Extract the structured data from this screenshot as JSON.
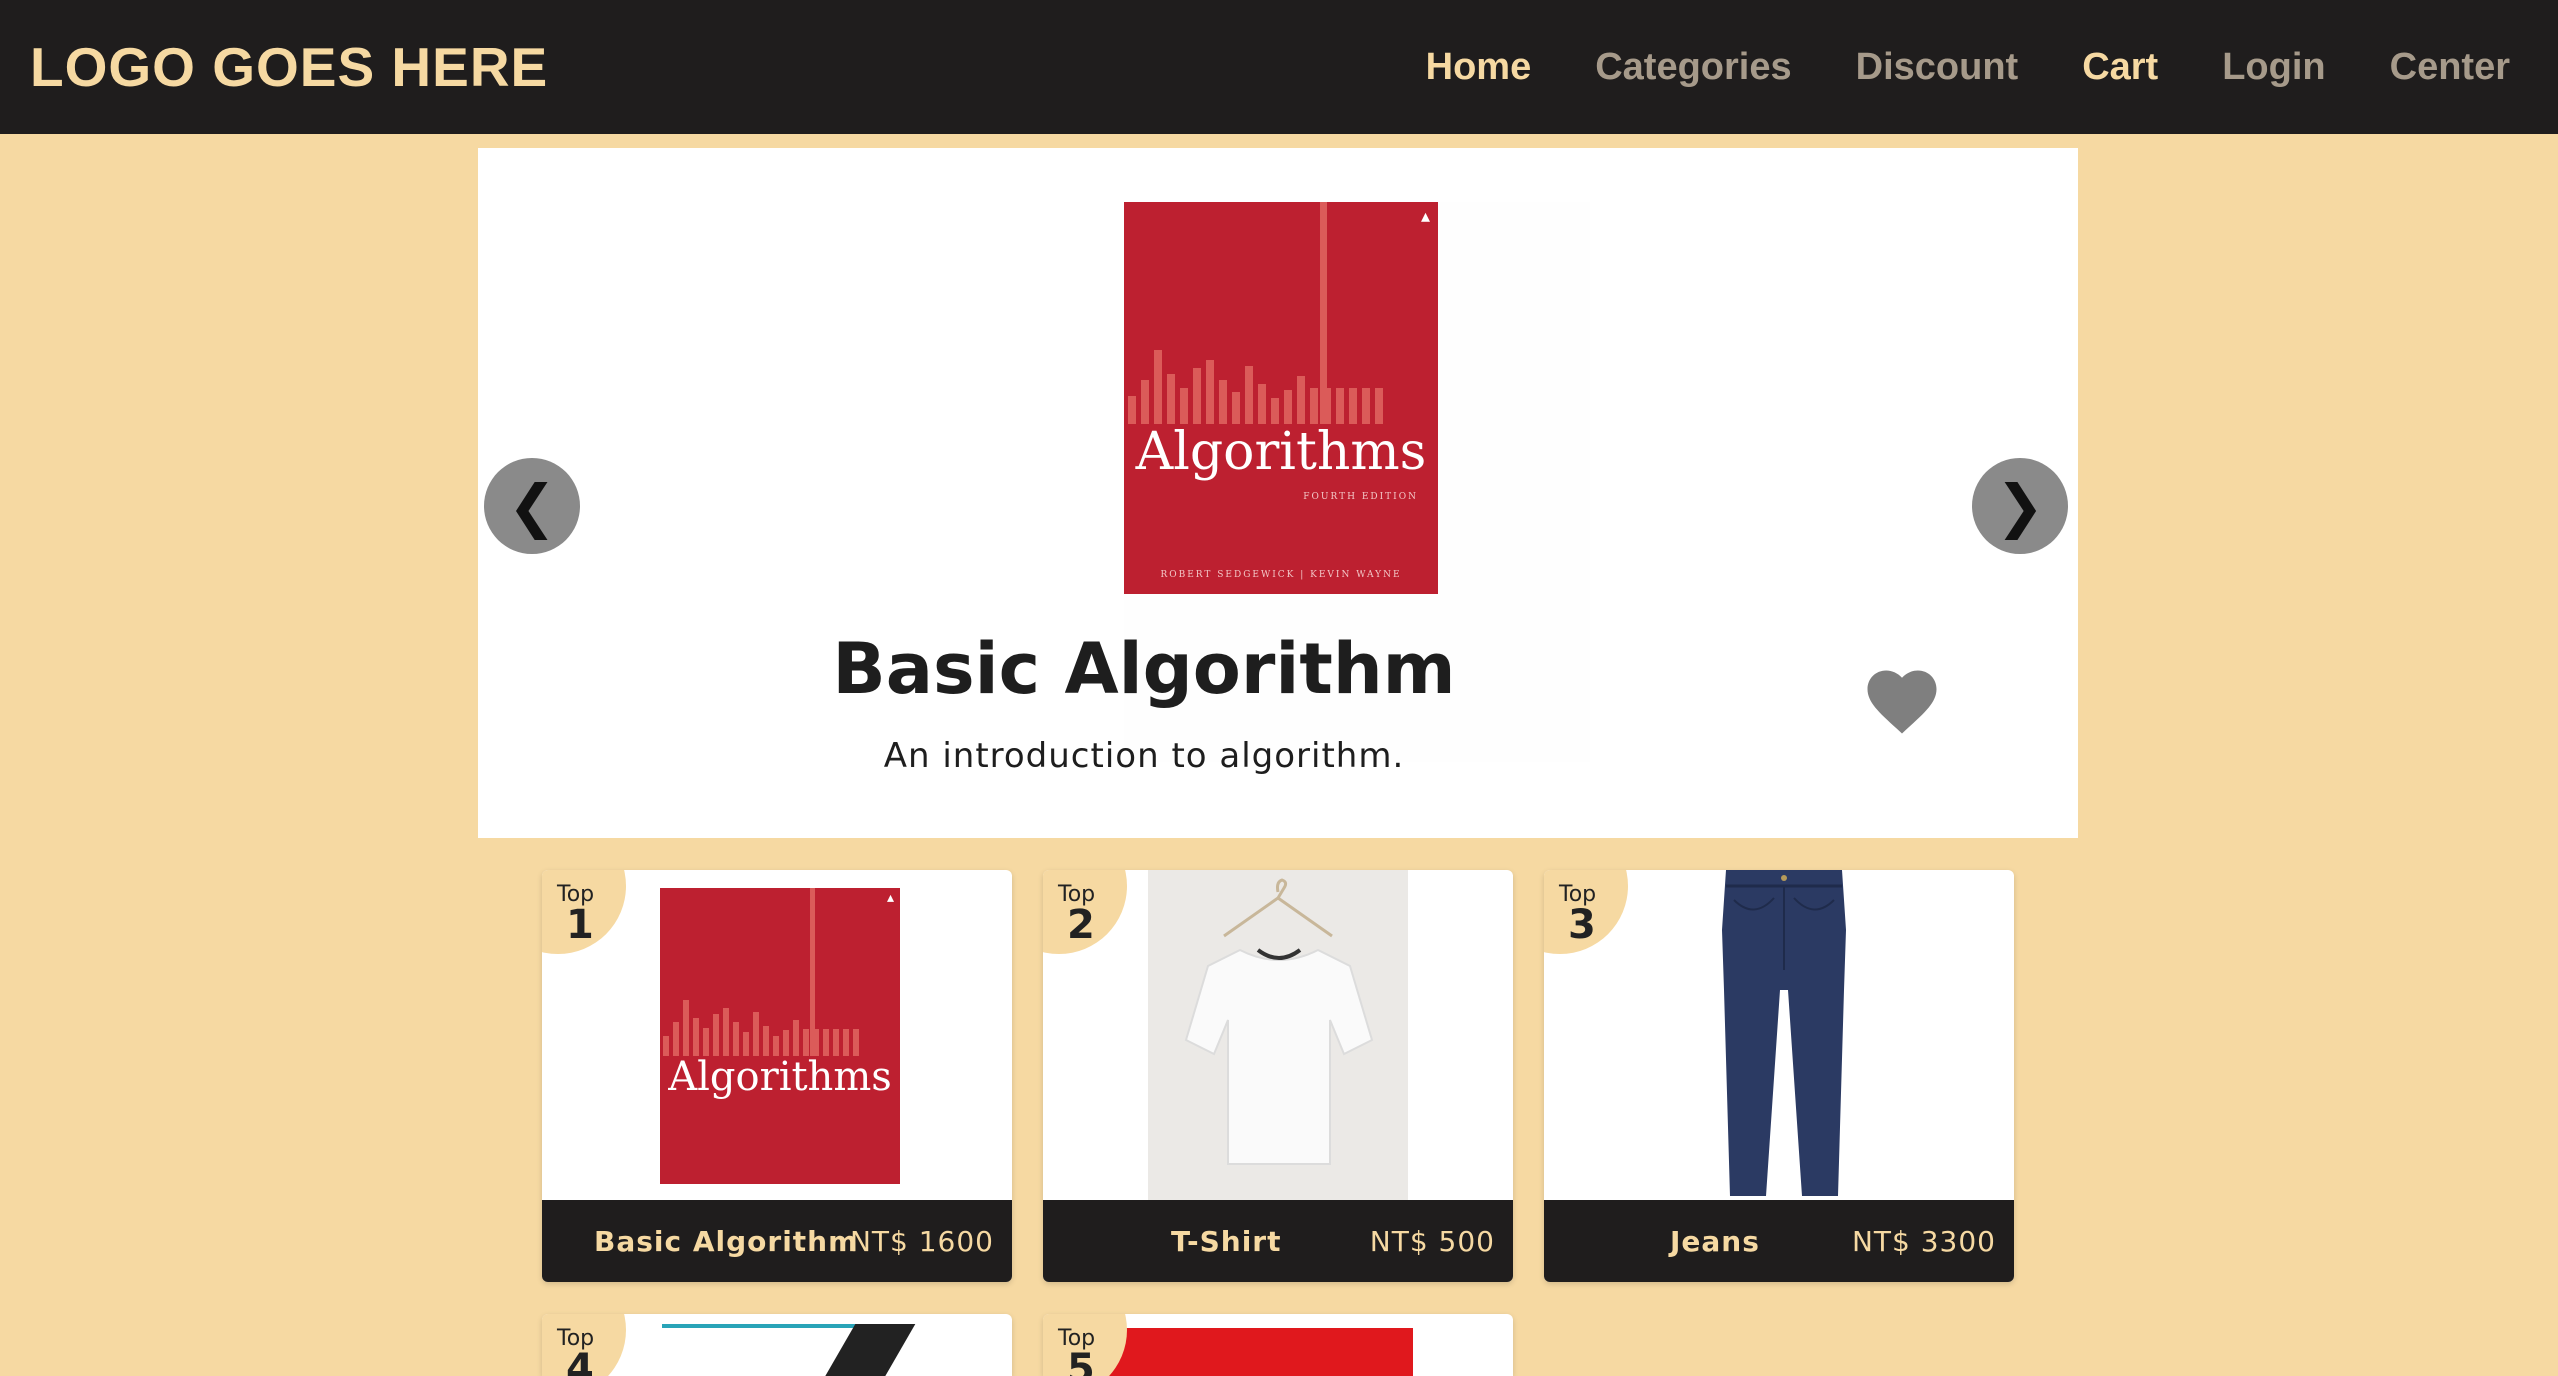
{
  "navbar": {
    "logo": "LOGO GOES HERE",
    "links": [
      {
        "label": "Home",
        "active": true
      },
      {
        "label": "Categories",
        "active": false
      },
      {
        "label": "Discount",
        "active": false
      },
      {
        "label": "Cart",
        "active": true
      },
      {
        "label": "Login",
        "active": false
      },
      {
        "label": "Center",
        "active": false
      }
    ]
  },
  "carousel": {
    "title": "Basic Algorithm",
    "description": "An introduction to algorithm.",
    "prev_icon": "❮",
    "next_icon": "❯",
    "book": {
      "cover_title": "Algorithms",
      "edition": "FOURTH EDITION",
      "authors": "ROBERT SEDGEWICK | KEVIN WAYNE"
    }
  },
  "products": [
    {
      "rank_label": "Top",
      "rank": "1",
      "name": "Basic Algorithm",
      "price": "NT$ 1600",
      "image": "algorithms-book"
    },
    {
      "rank_label": "Top",
      "rank": "2",
      "name": "T-Shirt",
      "price": "NT$ 500",
      "image": "white-tshirt"
    },
    {
      "rank_label": "Top",
      "rank": "3",
      "name": "Jeans",
      "price": "NT$ 3300",
      "image": "blue-jeans"
    },
    {
      "rank_label": "Top",
      "rank": "4",
      "image": "book-cover"
    },
    {
      "rank_label": "Top",
      "rank": "5",
      "image": "red-product"
    }
  ],
  "colors": {
    "background": "#f6d9a2",
    "navbar": "#1f1d1d",
    "accent": "#f6d9a2",
    "book_red": "#bd2030"
  }
}
